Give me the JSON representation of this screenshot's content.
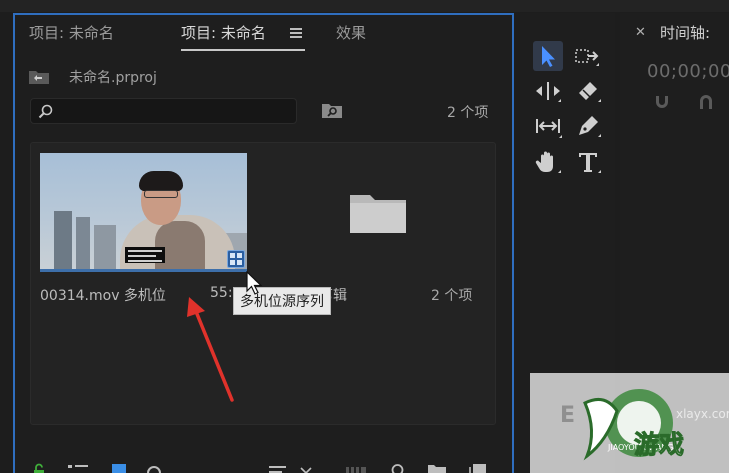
{
  "project_panel": {
    "tabs": [
      {
        "label": "项目: 未命名",
        "active": false
      },
      {
        "label": "项目: 未命名",
        "active": true
      },
      {
        "label": "效果",
        "active": false
      }
    ],
    "project_file": "未命名.prproj",
    "search": {
      "value": "",
      "placeholder": ""
    },
    "item_count": "2 个项",
    "items": [
      {
        "type": "multicam-source-sequence",
        "name": "00314.mov 多机位",
        "duration": "55:"
      },
      {
        "type": "bin",
        "name": "处理转剪辑",
        "count": "2 个项"
      }
    ],
    "tooltip": "多机位源序列"
  },
  "tools": [
    {
      "name": "selection-tool",
      "icon": "arrow-cursor-icon",
      "selected": true
    },
    {
      "name": "track-select-tool",
      "icon": "track-select-forward-icon",
      "selected": false
    },
    {
      "name": "ripple-edit-tool",
      "icon": "ripple-edit-icon",
      "selected": false
    },
    {
      "name": "razor-tool",
      "icon": "razor-icon",
      "selected": false
    },
    {
      "name": "slip-tool",
      "icon": "slip-icon",
      "selected": false
    },
    {
      "name": "pen-tool",
      "icon": "pen-icon",
      "selected": false
    },
    {
      "name": "hand-tool",
      "icon": "hand-icon",
      "selected": false
    },
    {
      "name": "type-tool",
      "icon": "type-icon",
      "selected": false
    }
  ],
  "timeline": {
    "title": "时间轴:",
    "timecode": "00;00;00"
  },
  "watermark": {
    "url": "xlayx.com",
    "sub": "JIAOYOUXIWANG",
    "brand": "游戏"
  },
  "colors": {
    "panel_focus_border": "#2f6ebf",
    "tooltip_bg": "#e9e9e9",
    "annotation_arrow": "#e0322b"
  }
}
